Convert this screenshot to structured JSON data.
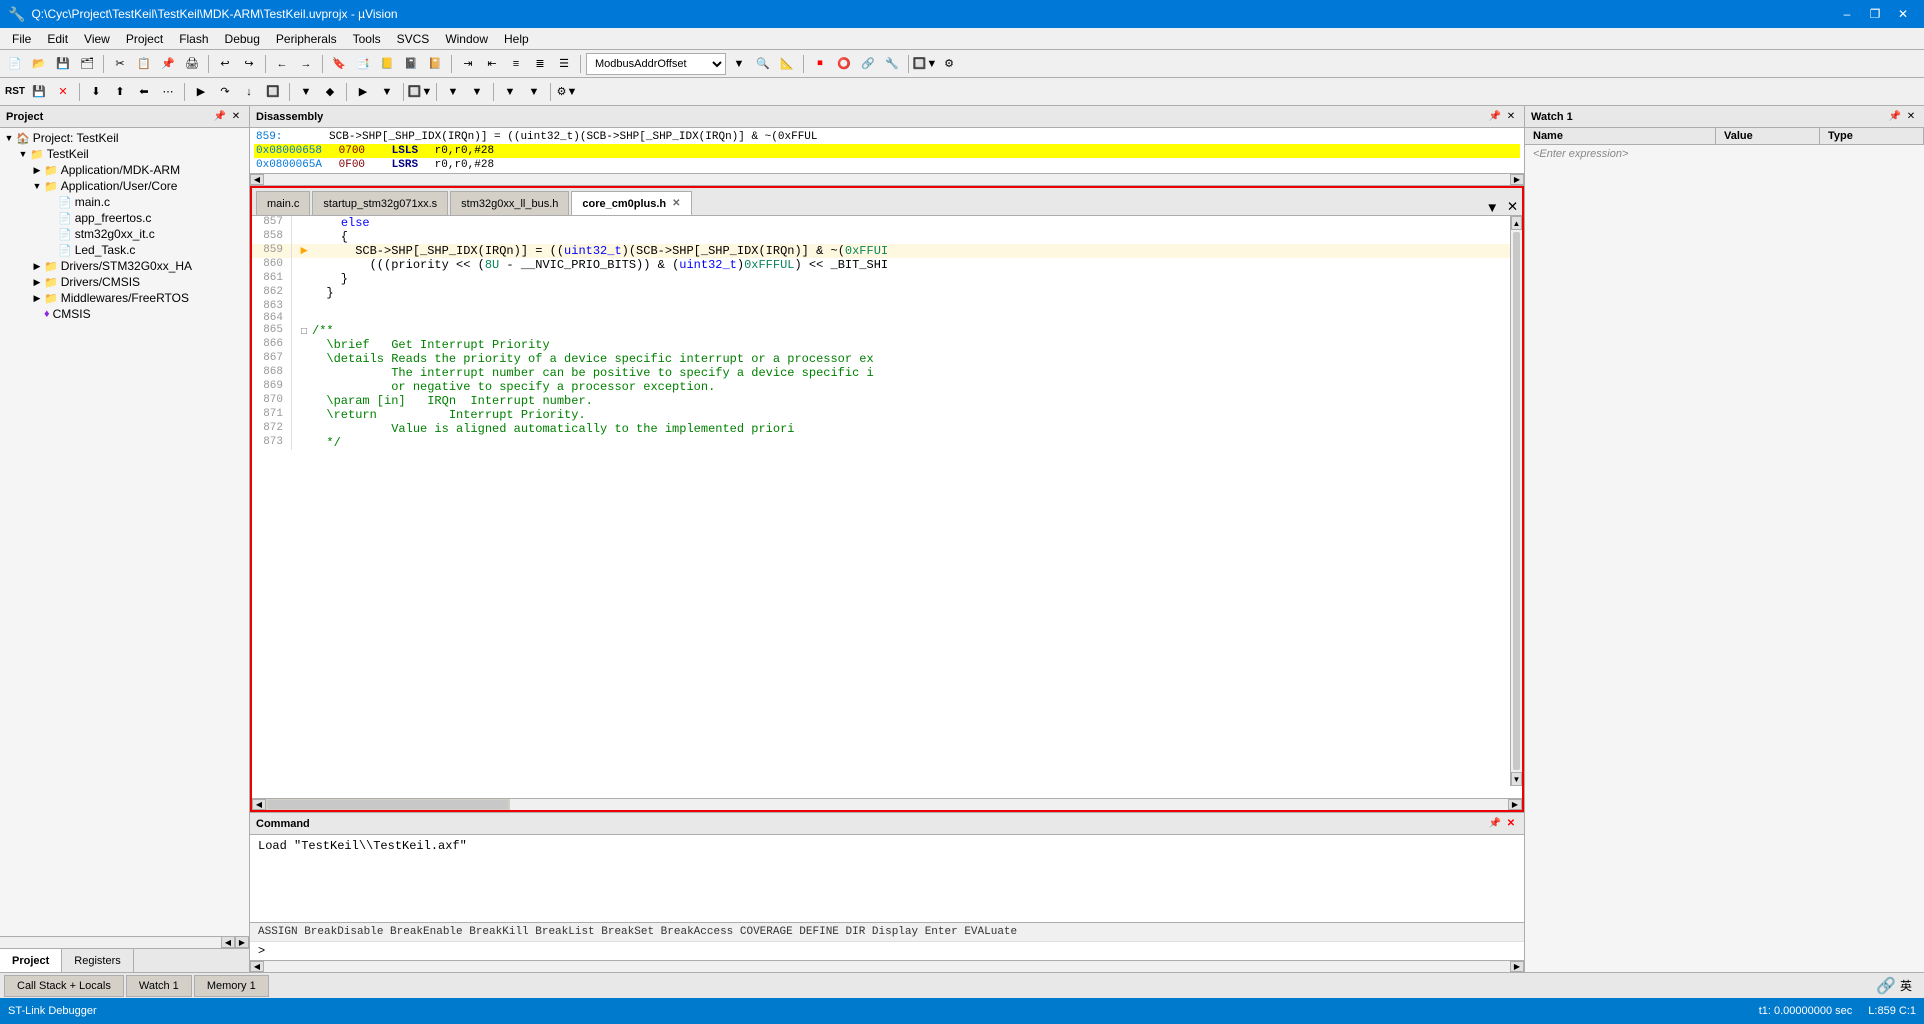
{
  "titleBar": {
    "title": "Q:\\Cyc\\Project\\TestKeil\\TestKeil\\MDK-ARM\\TestKeil.uvprojx - µVision",
    "minimize": "–",
    "maximize": "❐",
    "close": "✕"
  },
  "menuBar": {
    "items": [
      "File",
      "Edit",
      "View",
      "Project",
      "Flash",
      "Debug",
      "Peripherals",
      "Tools",
      "SVCS",
      "Window",
      "Help"
    ]
  },
  "disassembly": {
    "title": "Disassembly",
    "lines": [
      {
        "addr": "859:",
        "offset": "",
        "instr": "SCB->SHP[_SHP_IDX(IRQn)] = ((uint32_t)(SCB->SHP[_SHP_IDX(IRQn)] & ~(0xFFUL",
        "highlighted": false
      },
      {
        "addr": "0x08000658",
        "offset": "0700",
        "instr": "LSLS    r0,r0,#28",
        "highlighted": true
      },
      {
        "addr": "0x0800065A",
        "offset": "0F00",
        "instr": "LSRS    r0,r0,#28",
        "highlighted": false
      }
    ]
  },
  "codeTabs": [
    {
      "label": "main.c",
      "active": false,
      "closable": false
    },
    {
      "label": "startup_stm32g071xx.s",
      "active": false,
      "closable": false
    },
    {
      "label": "stm32g0xx_ll_bus.h",
      "active": false,
      "closable": false
    },
    {
      "label": "core_cm0plus.h",
      "active": true,
      "closable": true
    }
  ],
  "codeLines": [
    {
      "num": "857",
      "gutter": "",
      "content": "    else",
      "arrow": false
    },
    {
      "num": "858",
      "gutter": "",
      "content": "    {",
      "arrow": false
    },
    {
      "num": "859",
      "gutter": "►",
      "content": "      SCB->SHP[_SHP_IDX(IRQn)] = ((uint32_t)(SCB->SHP[_SHP_IDX(IRQn)] & ~(0xFFUI",
      "arrow": true
    },
    {
      "num": "860",
      "gutter": "",
      "content": "        (((priority << (8U - __NVIC_PRIO_BITS)) & (uint32_t)0xFFFUL) << _BIT_SHI",
      "arrow": false
    },
    {
      "num": "861",
      "gutter": "",
      "content": "    }",
      "arrow": false
    },
    {
      "num": "862",
      "gutter": "",
      "content": "  }",
      "arrow": false
    },
    {
      "num": "863",
      "gutter": "",
      "content": "",
      "arrow": false
    },
    {
      "num": "864",
      "gutter": "",
      "content": "",
      "arrow": false
    },
    {
      "num": "865",
      "gutter": "□",
      "content": "/**",
      "fold": true
    },
    {
      "num": "866",
      "gutter": "",
      "content": "  \\brief   Get Interrupt Priority",
      "comment": true
    },
    {
      "num": "867",
      "gutter": "",
      "content": "  \\details Reads the priority of a device specific interrupt or a processor ex",
      "comment": true
    },
    {
      "num": "868",
      "gutter": "",
      "content": "           The interrupt number can be positive to specify a device specific i",
      "comment": true
    },
    {
      "num": "869",
      "gutter": "",
      "content": "           or negative to specify a processor exception.",
      "comment": true
    },
    {
      "num": "870",
      "gutter": "",
      "content": "  \\param [in]   IRQn  Interrupt number.",
      "comment": true
    },
    {
      "num": "871",
      "gutter": "",
      "content": "  \\return          Interrupt Priority.",
      "comment": true
    },
    {
      "num": "872",
      "gutter": "",
      "content": "           Value is aligned automatically to the implemented priori",
      "comment": true
    },
    {
      "num": "873",
      "gutter": "",
      "content": "  */",
      "comment": true
    }
  ],
  "watchPanel": {
    "title": "Watch 1",
    "columns": [
      "Name",
      "Value",
      "Type"
    ],
    "inputPlaceholder": "<Enter expression>",
    "items": []
  },
  "projectPanel": {
    "title": "Project",
    "tree": [
      {
        "level": 0,
        "type": "project",
        "label": "Project: TestKeil",
        "expanded": true
      },
      {
        "level": 1,
        "type": "folder",
        "label": "TestKeil",
        "expanded": true
      },
      {
        "level": 2,
        "type": "folder",
        "label": "Application/MDK-ARM",
        "expanded": false
      },
      {
        "level": 2,
        "type": "folder",
        "label": "Application/User/Core",
        "expanded": true
      },
      {
        "level": 3,
        "type": "file",
        "label": "main.c"
      },
      {
        "level": 3,
        "type": "file",
        "label": "app_freertos.c"
      },
      {
        "level": 3,
        "type": "file",
        "label": "stm32g0xx_it.c"
      },
      {
        "level": 3,
        "type": "file",
        "label": "Led_Task.c"
      },
      {
        "level": 2,
        "type": "folder",
        "label": "Drivers/STM32G0xx_HA",
        "expanded": false
      },
      {
        "level": 2,
        "type": "folder",
        "label": "Drivers/CMSIS",
        "expanded": false
      },
      {
        "level": 2,
        "type": "folder",
        "label": "Middlewares/FreeRTOS",
        "expanded": false
      },
      {
        "level": 2,
        "type": "gem",
        "label": "CMSIS"
      }
    ],
    "tabs": [
      "Project",
      "Registers"
    ]
  },
  "commandPanel": {
    "title": "Command",
    "content": "Load \"TestKeil\\\\TestKeil.axf\"",
    "hints": "ASSIGN  BreakDisable  BreakEnable  BreakKill  BreakList  BreakSet  BreakAccess  COVERAGE  DEFINE  DIR  Display  Enter  EVALuate",
    "prompt": ">"
  },
  "statusBar": {
    "left": "ST-Link Debugger",
    "time": "t1: 0.00000000 sec",
    "position": "L:859 C:1",
    "icons": "英"
  },
  "bottomTabs": [
    {
      "label": "Call Stack + Locals",
      "active": false
    },
    {
      "label": "Watch 1",
      "active": false
    },
    {
      "label": "Memory 1",
      "active": false
    }
  ],
  "toolbar1": {
    "dropdown": "ModbusAddrOffset"
  }
}
